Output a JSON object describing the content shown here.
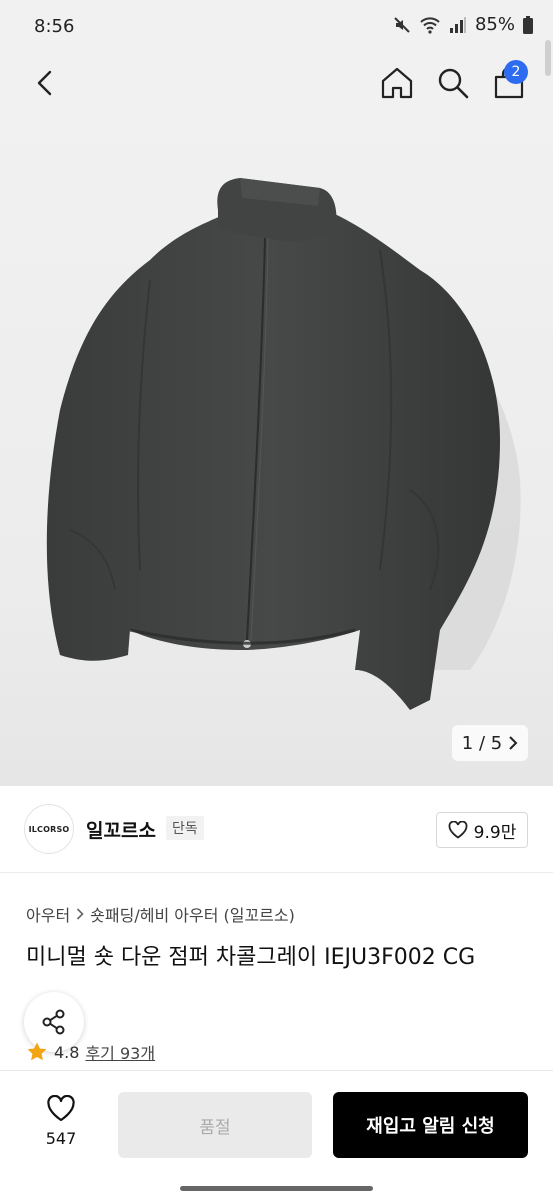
{
  "status_bar": {
    "time": "8:56",
    "battery": "85%"
  },
  "header": {
    "cart_count": "2"
  },
  "gallery": {
    "page_indicator": "1 / 5",
    "background": "#f1f1f1",
    "jacket_color": "#3d3f3f"
  },
  "brand": {
    "logo_text": "ILCORSO",
    "name": "일꼬르소",
    "tag": "단독",
    "likes": "9.9만"
  },
  "product": {
    "breadcrumb_1": "아우터",
    "breadcrumb_2": "숏패딩/헤비 아우터 (일꼬르소)",
    "title": "미니멀 숏 다운 점퍼 차콜그레이 IEJU3F002 CG",
    "rating": "4.8",
    "reviews": "후기 93개"
  },
  "bottom_bar": {
    "wish_count": "547",
    "soldout_label": "품절",
    "restock_label": "재입고 알림 신청"
  },
  "colors": {
    "accent_blue": "#2d6cf0",
    "star": "#f2a413",
    "primary_button": "#000000"
  }
}
